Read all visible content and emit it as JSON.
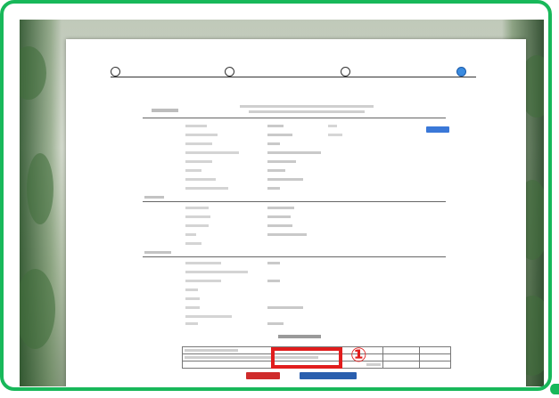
{
  "steps": [
    {
      "active": false
    },
    {
      "active": false
    },
    {
      "active": false
    },
    {
      "active": true
    }
  ],
  "annotation": {
    "marker": "①",
    "color": "#e11d1d"
  },
  "colors": {
    "frame": "#18b85a",
    "cancel": "#cf2b2b",
    "confirm": "#2a5fae",
    "step_active": "#3a8be0"
  },
  "icons": [
    "step-dot-icon"
  ]
}
